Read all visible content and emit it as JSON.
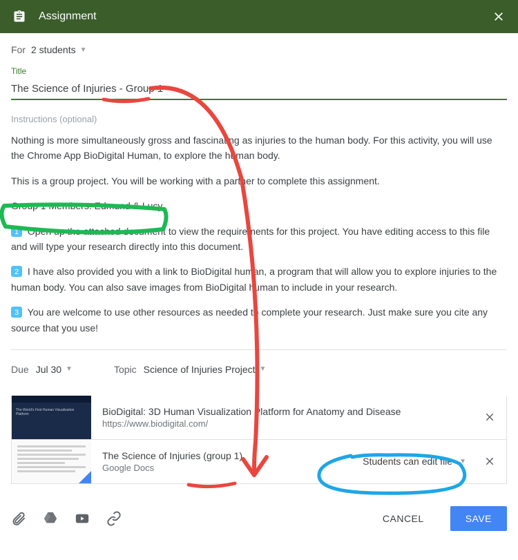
{
  "header": {
    "title": "Assignment"
  },
  "for": {
    "label": "For",
    "value": "2 students"
  },
  "title": {
    "label": "Title",
    "value": "The Science of Injuries - Group 1"
  },
  "instructions": {
    "label": "Instructions (optional)",
    "p1": "Nothing is more simultaneously gross and fascinating as injuries to the human body. For this activity, you will use the Chrome App BioDigital Human, to explore the human body.",
    "p2": "This is a group project. You will be working with a partner to complete this assignment.",
    "p3": "Group 1 Members: Edmund & Lucy",
    "n1": "Open up the attached document to view the requirements for this project. You have editing access to this file and will type your research directly into this document.",
    "n2": "I have also provided you with a link to BioDigital human, a program that will allow you to explore injuries to the human body. You can also save images from BioDigital human to include in your research.",
    "n3": "You are welcome to use other resources as needed to complete your research. Just make sure you cite any source that you use!"
  },
  "due": {
    "label": "Due",
    "value": "Jul 30"
  },
  "topic": {
    "label": "Topic",
    "value": "Science of Injuries Project"
  },
  "attachments": [
    {
      "title": "BioDigital: 3D Human Visualization Platform for Anatomy and Disease",
      "sub": "https://www.biodigital.com/"
    },
    {
      "title": "The Science of Injuries (group 1)",
      "sub": "Google Docs",
      "perm": "Students can edit file"
    }
  ],
  "footer": {
    "cancel": "CANCEL",
    "save": "SAVE"
  }
}
